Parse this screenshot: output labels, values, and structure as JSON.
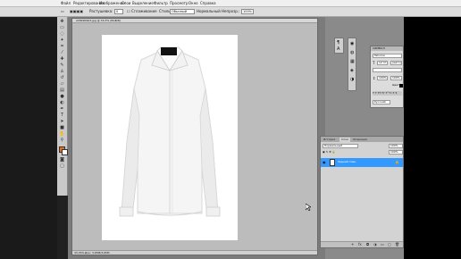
{
  "menu": [
    "Файл",
    "Редактирование",
    "Изображение",
    "Слои",
    "Выделение",
    "Фильтр",
    "Просмотр",
    "Окно",
    "Справка"
  ],
  "options": {
    "feather_label": "Растушевка:",
    "feather_value": "0",
    "antialias_label": "Сглаживание",
    "style_label": "Стиль:",
    "style_value": "Обычный",
    "mode_label": "Нормальный",
    "opacity_label": "Непрозр.:",
    "opacity_value": "100%"
  },
  "document": {
    "tab_title": "228290903.jpg @ 33,3% (RGB/8)",
    "status": "Док: 3,65M/3,65M",
    "zoom": "33,33%"
  },
  "character_panel": {
    "title": "СИМВОЛ",
    "font": "Tahoma",
    "size": "12 пт",
    "leading": "(Авто)",
    "scale_v": "100%",
    "scale_h": "100%",
    "color_label": "Цвет:",
    "language": "Русский"
  },
  "layers_panel": {
    "tabs": [
      "История",
      "Слои",
      "Операции"
    ],
    "blend_mode": "Нормальный",
    "opacity": "100%",
    "fill": "100%",
    "layer_name": "Задний план"
  },
  "colors": {
    "layer_selected": "#3399ff",
    "workspace": "#7b7b7b",
    "canvas": "#ffffff"
  },
  "icons": [
    "move-tool-icon",
    "marquee-tool-icon",
    "lasso-tool-icon",
    "magic-wand-icon",
    "crop-icon",
    "eyedropper-icon",
    "healing-brush-icon",
    "brush-icon",
    "clone-stamp-icon",
    "history-brush-icon",
    "eraser-icon",
    "gradient-icon",
    "blur-icon",
    "dodge-icon",
    "pen-icon",
    "type-icon",
    "path-select-icon",
    "shape-icon",
    "hand-icon",
    "zoom-icon"
  ]
}
